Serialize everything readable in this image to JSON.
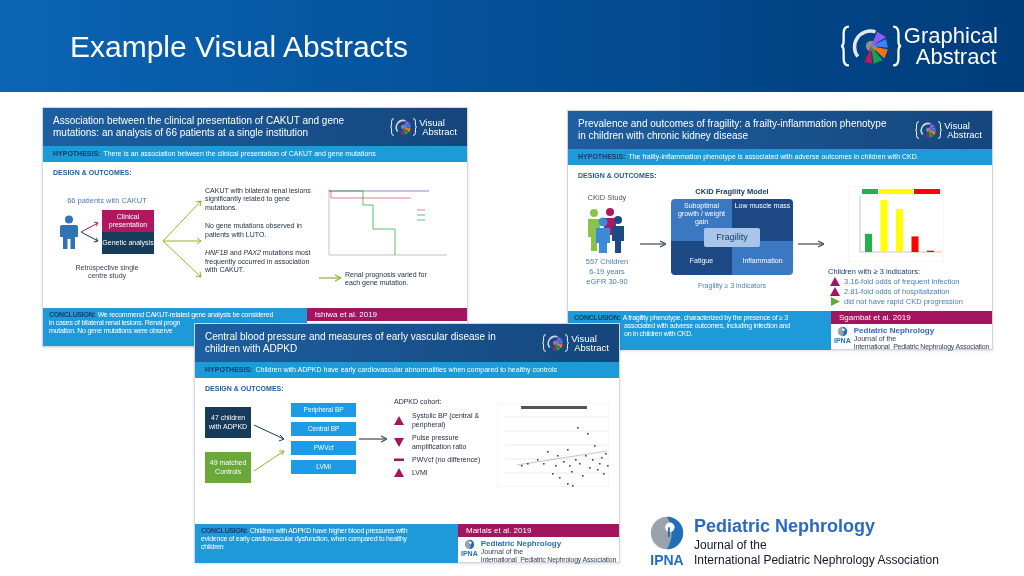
{
  "slide": {
    "title": "Example Visual Abstracts",
    "logo": [
      "Graphical",
      "Abstract"
    ]
  },
  "abstract_cakut": {
    "title": "Association between the clinical presentation of CAKUT and gene mutations: an analysis of 66 patients at a single institution",
    "logo": [
      "Visual",
      "Abstract"
    ],
    "hypothesis": {
      "label": "HYPOTHESIS:",
      "text": "There is an association between the clinical presentation of CAKUT and gene mutations"
    },
    "design_label": "DESIGN & OUTCOMES:",
    "patients": "66 patients with CAKUT",
    "boxes": [
      {
        "label": "Clinical presentation",
        "color": "#b0175f"
      },
      {
        "label": "Genetic analysis",
        "color": "#173b5a"
      }
    ],
    "study": "Retrospective single centre study",
    "findings": [
      "CAKUT with bilateral renal lesions significantly related to gene mutations.",
      "No gene mutations observed in patients with LUTO.",
      "*HNF1B* and *PAX2* mutations most frequently occurred in association with CAKUT."
    ],
    "outcome": "Renal prognosis varied for each gene mutation.",
    "conclusion": {
      "label": "CONCLUSION:",
      "lines": [
        "We recommend CAKUT-related gene analysis be considered",
        "in cases of bilateral renal lesions. Renal progn",
        "mutation. No gene mutations were observe"
      ]
    },
    "citation": "Ishiwa et al. 2019"
  },
  "abstract_fragility": {
    "title": "Prevalence and outcomes of fragility: a frailty-inflammation phenotype in children with chronic kidney disease",
    "logo": [
      "Visual",
      "Abstract"
    ],
    "hypothesis": {
      "label": "HYPOTHESIS:",
      "text": "The frailty-inflammation phenotype is associated with adverse outcomes in children with CKD."
    },
    "design_label": "DESIGN & OUTCOMES:",
    "study": "CKiD Study",
    "stats": [
      "557 Children",
      "6-19 years",
      "eGFR 30-90"
    ],
    "model_title": "CKiD Fragility Model",
    "model_cells": [
      {
        "label": "Suboptimal growth / weight gain",
        "color": "#3a78c2"
      },
      {
        "label": "Low muscle mass",
        "color": "#1d4a84"
      },
      {
        "label": "Fatigue",
        "color": "#1d4a84"
      },
      {
        "label": "Inflammation",
        "color": "#3a78c2"
      }
    ],
    "model_center": "Fragility",
    "model_caption": "Fragility ≥ 3 indicators",
    "results_title": "Children with ≥ 3 indicators:",
    "results": [
      {
        "kind": "up",
        "text": "3.16-fold odds of frequent infection"
      },
      {
        "kind": "up",
        "text": "2.81-fold odds of hospitalization"
      },
      {
        "kind": "right",
        "text": "did not have rapid CKD progression"
      }
    ],
    "conclusion": {
      "label": "CONCLUSION:",
      "lines": [
        "A fragility phenotype, characterized by the presence of ≥ 3",
        "associated with adverse outcomes, including infection and",
        "on in children with CKD."
      ]
    },
    "citation": "Sgambat et al. 2019",
    "journal": {
      "name": "Pediatric Nephrology",
      "subtitle": "Journal of the",
      "acronym": "IPNA",
      "org": "International  Pediatric Nephrology Association"
    }
  },
  "abstract_adpkd": {
    "title": "Central blood pressure and measures of early vascular disease in children with ADPKD",
    "logo": [
      "Visual",
      "Abstract"
    ],
    "hypothesis": {
      "label": "HYPOTHESIS:",
      "text": "Children with ADPKD have early cardiovascular abnormalities when compared to healthy controls"
    },
    "design_label": "DESIGN & OUTCOMES:",
    "groups": [
      {
        "label": "47 children with ADPKD",
        "color": "#173b5a"
      },
      {
        "label": "49 matched Controls",
        "color": "#6aa83a"
      }
    ],
    "measures": [
      "Peripheral BP",
      "Central BP",
      "PWVcf",
      "LVMI"
    ],
    "cohort_title": "ADPKD cohort:",
    "results": [
      {
        "kind": "up",
        "text": "Systolic BP (central & peripheral)"
      },
      {
        "kind": "down",
        "text": "Pulse pressure amplification ratio"
      },
      {
        "kind": "dash",
        "text": "PWVcf (no difference)"
      },
      {
        "kind": "up",
        "text": "LVMI"
      }
    ],
    "conclusion": {
      "label": "CONCLUSION:",
      "lines": [
        "Children with ADPKD have higher blood pressures with",
        "evidence of early cardiovascular dysfunction, when compared to healthy",
        "children"
      ]
    },
    "citation": "Marlais et al. 2019",
    "journal": {
      "name": "Pediatric Nephrology",
      "subtitle": "Journal of the",
      "acronym": "IPNA",
      "org": "International  Pediatric Nephrology Association"
    }
  },
  "journal": {
    "name": "Pediatric Nephrology",
    "subtitle": "Journal of the",
    "acronym": "IPNA",
    "org": "International Pediatric Nephrology Association"
  }
}
